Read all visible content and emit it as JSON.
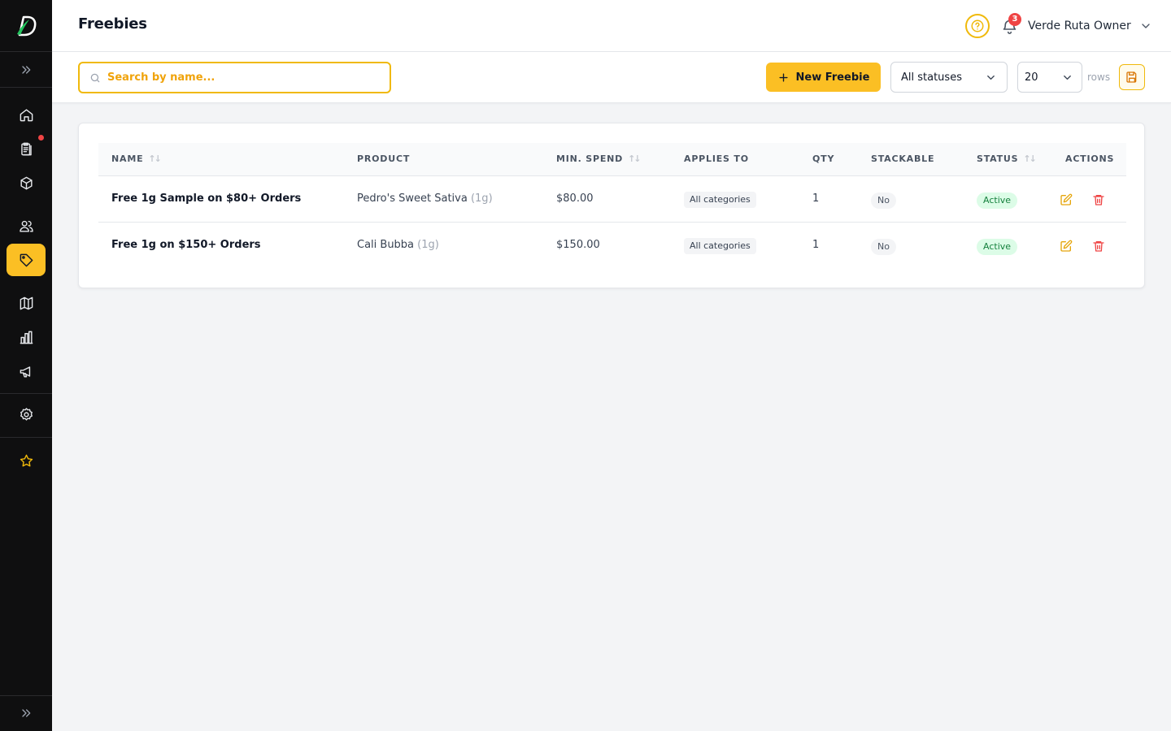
{
  "header": {
    "title": "Freebies",
    "notification_count": "3",
    "user_name": "Verde Ruta Owner"
  },
  "sidebar": {
    "items": [
      {
        "icon": "home-icon"
      },
      {
        "icon": "orders-icon",
        "has_dot": true
      },
      {
        "icon": "box-icon"
      },
      {
        "icon": "users-icon"
      },
      {
        "icon": "tag-icon",
        "active": true
      },
      {
        "icon": "map-icon"
      },
      {
        "icon": "chart-icon"
      },
      {
        "icon": "megaphone-icon"
      },
      {
        "icon": "gear-icon"
      },
      {
        "icon": "star-icon"
      }
    ]
  },
  "toolbar": {
    "search_placeholder": "Search by name...",
    "new_label": "New Freebie",
    "status_value": "All statuses",
    "rows_value": "20",
    "rows_label": "rows"
  },
  "table": {
    "headers": {
      "name": "NAME",
      "product": "PRODUCT",
      "min_spend": "MIN. SPEND",
      "applies_to": "APPLIES TO",
      "qty": "QTY",
      "stackable": "STACKABLE",
      "status": "STATUS",
      "actions": "ACTIONS"
    },
    "rows": [
      {
        "name": "Free 1g Sample on $80+ Orders",
        "product": "Pedro's Sweet Sativa",
        "product_size": "(1g)",
        "min_spend": "$80.00",
        "applies_to": "All categories",
        "qty": "1",
        "stackable": "No",
        "status": "Active"
      },
      {
        "name": "Free 1g on $150+ Orders",
        "product": "Cali Bubba",
        "product_size": "(1g)",
        "min_spend": "$150.00",
        "applies_to": "All categories",
        "qty": "1",
        "stackable": "No",
        "status": "Active"
      }
    ]
  },
  "colors": {
    "accent": "#fbbf24",
    "sidebar_bg": "#0f0f10",
    "danger": "#ef4444",
    "success": "#15803d"
  }
}
